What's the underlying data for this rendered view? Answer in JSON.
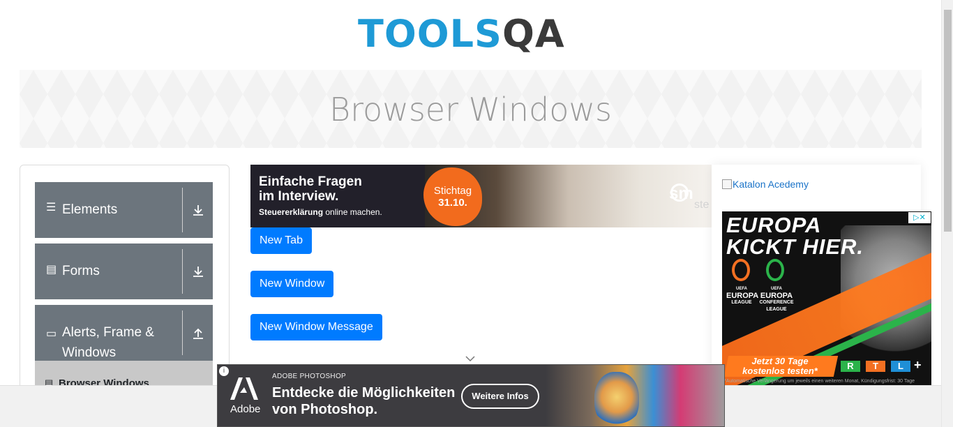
{
  "header": {
    "logo_tools": "TOOLS",
    "logo_qa": "QA"
  },
  "banner": {
    "title": "Browser Windows"
  },
  "sidebar": {
    "groups": [
      {
        "label": "Elements",
        "icon": "hamburger-icon",
        "arrow": "download-icon"
      },
      {
        "label": "Forms",
        "icon": "document-icon",
        "arrow": "download-icon"
      },
      {
        "label_line1": "Alerts, Frame &",
        "label_line2": "Windows",
        "icon": "window-icon",
        "arrow": "upload-icon"
      }
    ],
    "active_item": {
      "label": "Browser Windows",
      "icon": "document-icon"
    }
  },
  "ad_top": {
    "headline_line1": "Einfache Fragen",
    "headline_line2": "im Interview.",
    "sub_bold": "Steuererklärung",
    "sub_rest": " online machen.",
    "badge_line1": "Stichtag",
    "badge_line2": "31.10.",
    "brand_fragment": "sm",
    "brand_sub_fragment": "ste",
    "badge_color": "#f26b1d"
  },
  "buttons": {
    "new_tab": "New Tab",
    "new_window": "New Window",
    "new_window_message": "New Window Message",
    "color": "#007bff"
  },
  "aside": {
    "katalon_alt": "Katalon Acedemy"
  },
  "ad_right": {
    "headline_line1": "EUROPA",
    "headline_line2": "KICKT HIER.",
    "league1_l1": "UEFA",
    "league1_l2": "EUROPA",
    "league1_l3": "LEAGUE",
    "league2_l1": "UEFA",
    "league2_l2": "EUROPA",
    "league2_l3": "CONFERENCE",
    "league2_l4": "LEAGUE",
    "cta_line1": "Jetzt 30 Tage",
    "cta_line2": "kostenlos testen*",
    "rtl_letters": [
      "R",
      "T",
      "L"
    ],
    "plus": "+",
    "fine_print": "*Automatische Verlängerung um jeweils einen weiteren Monat, Kündigungsfrist: 30 Tage",
    "adchoices": "▷✕"
  },
  "ad_bottom": {
    "brand": "Adobe",
    "label": "ADOBE PHOTOSHOP",
    "headline_line1": "Entdecke die Möglichkeiten",
    "headline_line2": "von Photoshop.",
    "cta": "Weitere Infos"
  }
}
